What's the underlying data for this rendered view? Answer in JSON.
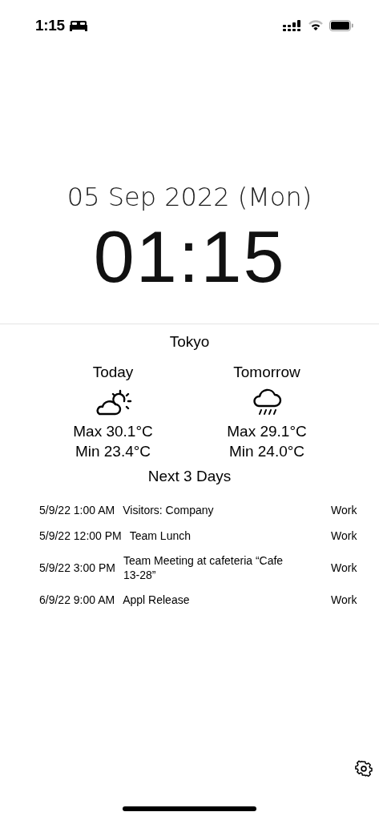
{
  "status_bar": {
    "time": "1:15"
  },
  "date": "05 Sep 2022 (Mon)",
  "clock": "01:15",
  "weather": {
    "city": "Tokyo",
    "days": [
      {
        "label": "Today",
        "kind": "partly-sunny",
        "max": "Max 30.1°C",
        "min": "Min 23.4°C"
      },
      {
        "label": "Tomorrow",
        "kind": "rain",
        "max": "Max 29.1°C",
        "min": "Min 24.0°C"
      }
    ]
  },
  "events": {
    "title": "Next 3 Days",
    "rows": [
      {
        "time": "5/9/22 1:00 AM",
        "title": "Visitors: Company",
        "calendar": "Work"
      },
      {
        "time": "5/9/22 12:00 PM",
        "title": "Team Lunch",
        "calendar": "Work"
      },
      {
        "time": "5/9/22 3:00 PM",
        "title": "Team Meeting at cafeteria “Cafe 13-28”",
        "calendar": "Work"
      },
      {
        "time": "6/9/22 9:00 AM",
        "title": "Appl Release",
        "calendar": "Work"
      }
    ]
  }
}
